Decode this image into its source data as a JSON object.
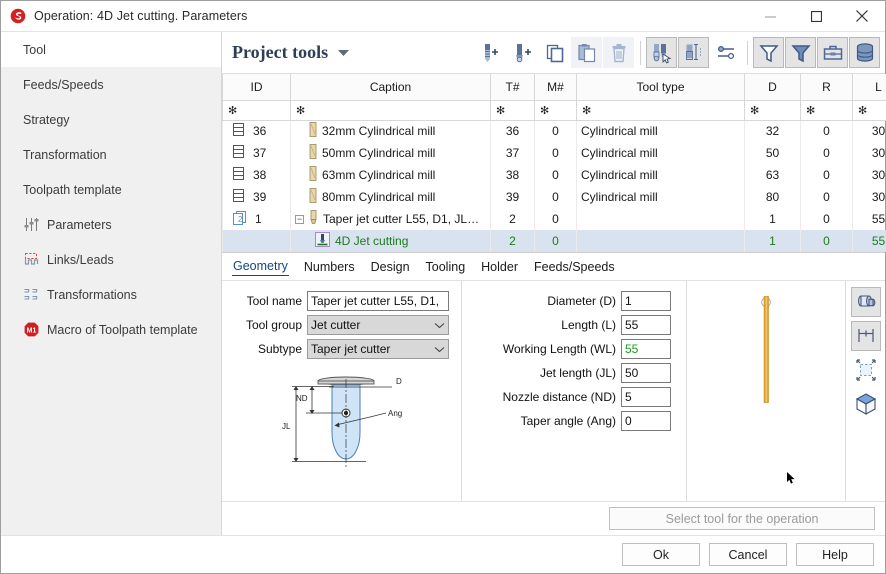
{
  "window": {
    "title": "Operation: 4D Jet cutting. Parameters",
    "logo_icon": "app-logo-icon",
    "minimize_label": "—",
    "maximize_label": "□",
    "close_label": "✕"
  },
  "sidebar": {
    "items": [
      {
        "label": "Tool",
        "icon": "",
        "active": true
      },
      {
        "label": "Feeds/Speeds",
        "icon": "",
        "active": false
      },
      {
        "label": "Strategy",
        "icon": "",
        "active": false
      },
      {
        "label": "Transformation",
        "icon": "",
        "active": false
      },
      {
        "label": "Toolpath template",
        "icon": "",
        "active": false
      },
      {
        "label": "Parameters",
        "icon": "sliders-icon",
        "active": false
      },
      {
        "label": "Links/Leads",
        "icon": "links-leads-icon",
        "active": false
      },
      {
        "label": "Transformations",
        "icon": "transformations-icon",
        "active": false
      },
      {
        "label": "Macro of Toolpath template",
        "icon": "macro-m1-icon",
        "active": false
      }
    ]
  },
  "toolbar": {
    "panel_title": "Project tools",
    "caret_icon": "chevron-down-icon",
    "buttons": [
      {
        "name": "add-tool-button",
        "icon": "drill-plus-icon"
      },
      {
        "name": "add-assembly-button",
        "icon": "endmill-plus-icon"
      },
      {
        "name": "copy-button",
        "icon": "copy-icon"
      },
      {
        "name": "paste-button",
        "icon": "paste-icon"
      },
      {
        "name": "delete-button",
        "icon": "trash-icon"
      },
      {
        "name": "select-tool-button",
        "icon": "tool-pick-icon"
      },
      {
        "name": "measure-tool-button",
        "icon": "tool-measure-icon"
      },
      {
        "name": "tool-settings-button",
        "icon": "sliders-h-icon"
      },
      {
        "name": "filter-button",
        "icon": "funnel-icon"
      },
      {
        "name": "filter-applied-button",
        "icon": "funnel-filled-icon"
      },
      {
        "name": "toolbox-button",
        "icon": "toolbox-icon"
      },
      {
        "name": "database-button",
        "icon": "database-icon"
      }
    ]
  },
  "table": {
    "columns": [
      "ID",
      "Caption",
      "T#",
      "M#",
      "Tool type",
      "D",
      "R",
      "L"
    ],
    "filter_marker": "✻",
    "rows": [
      {
        "icon": "tool-record-icon",
        "id": "36",
        "caption": "32mm Cylindrical mill",
        "caption_icon": "cylindrical-mill-icon",
        "t": "36",
        "m": "0",
        "type": "Cylindrical mill",
        "d": "32",
        "r": "0",
        "l": "30",
        "expander": "",
        "selected": false,
        "indent": 0
      },
      {
        "icon": "tool-record-icon",
        "id": "37",
        "caption": "50mm Cylindrical mill",
        "caption_icon": "cylindrical-mill-icon",
        "t": "37",
        "m": "0",
        "type": "Cylindrical mill",
        "d": "50",
        "r": "0",
        "l": "30",
        "expander": "",
        "selected": false,
        "indent": 0
      },
      {
        "icon": "tool-record-icon",
        "id": "38",
        "caption": "63mm Cylindrical mill",
        "caption_icon": "cylindrical-mill-icon",
        "t": "38",
        "m": "0",
        "type": "Cylindrical mill",
        "d": "63",
        "r": "0",
        "l": "30",
        "expander": "",
        "selected": false,
        "indent": 0
      },
      {
        "icon": "tool-record-icon",
        "id": "39",
        "caption": "80mm Cylindrical mill",
        "caption_icon": "cylindrical-mill-icon",
        "t": "39",
        "m": "0",
        "type": "Cylindrical mill",
        "d": "80",
        "r": "0",
        "l": "30",
        "expander": "",
        "selected": false,
        "indent": 0
      },
      {
        "icon": "assembly-record-icon",
        "id": "1",
        "caption": "Taper jet cutter L55, D1, JL…",
        "caption_icon": "jet-cutter-icon",
        "t": "2",
        "m": "0",
        "type": "",
        "d": "1",
        "r": "0",
        "l": "55",
        "expander": "−",
        "selected": false,
        "indent": 0
      },
      {
        "icon": "",
        "id": "",
        "caption": "4D Jet cutting",
        "caption_icon": "jet-cutting-op-icon",
        "t": "2",
        "m": "0",
        "type": "",
        "d": "1",
        "r": "0",
        "l": "55",
        "expander": "",
        "selected": true,
        "indent": 1
      }
    ],
    "scroll_up_icon": "chevron-up-icon",
    "scroll_down_icon": "chevron-down-icon"
  },
  "tabs": [
    {
      "label": "Geometry",
      "active": true
    },
    {
      "label": "Numbers",
      "active": false
    },
    {
      "label": "Design",
      "active": false
    },
    {
      "label": "Tooling",
      "active": false
    },
    {
      "label": "Holder",
      "active": false
    },
    {
      "label": "Feeds/Speeds",
      "active": false
    }
  ],
  "form": {
    "tool_name_label": "Tool name",
    "tool_name_value": "Taper jet cutter L55, D1,",
    "tool_group_label": "Tool group",
    "tool_group_value": "Jet cutter",
    "subtype_label": "Subtype",
    "subtype_value": "Taper jet cutter",
    "dropdown_icon": "chevron-down-icon",
    "diagram": {
      "name": "taper-jet-cutter-diagram",
      "labels": {
        "d": "D",
        "nd": "ND",
        "jl": "JL",
        "ang": "Ang"
      }
    }
  },
  "params": [
    {
      "label": "Diameter (D)",
      "value": "1",
      "green": false,
      "name": "diameter-field"
    },
    {
      "label": "Length (L)",
      "value": "55",
      "green": false,
      "name": "length-field"
    },
    {
      "label": "Working Length (WL)",
      "value": "55",
      "green": true,
      "name": "working-length-field"
    },
    {
      "label": "Jet length (JL)",
      "value": "50",
      "green": false,
      "name": "jet-length-field"
    },
    {
      "label": "Nozzle distance (ND)",
      "value": "5",
      "green": false,
      "name": "nozzle-distance-field"
    },
    {
      "label": "Taper angle (Ang)",
      "value": "0",
      "green": false,
      "name": "taper-angle-field"
    }
  ],
  "preview": {
    "tool_color": "#e8a72c",
    "side_buttons": [
      {
        "name": "view-3d-solid-button",
        "icon": "solid-tool-icon",
        "framed": true
      },
      {
        "name": "view-dimensions-button",
        "icon": "dimensions-icon",
        "framed": true
      },
      {
        "name": "fit-view-button",
        "icon": "fit-to-view-icon",
        "framed": false
      },
      {
        "name": "view-cube-button",
        "icon": "cube-icon",
        "framed": false
      }
    ]
  },
  "footer": {
    "select_tool_label": "Select tool for the operation",
    "ok_label": "Ok",
    "cancel_label": "Cancel",
    "help_label": "Help"
  }
}
